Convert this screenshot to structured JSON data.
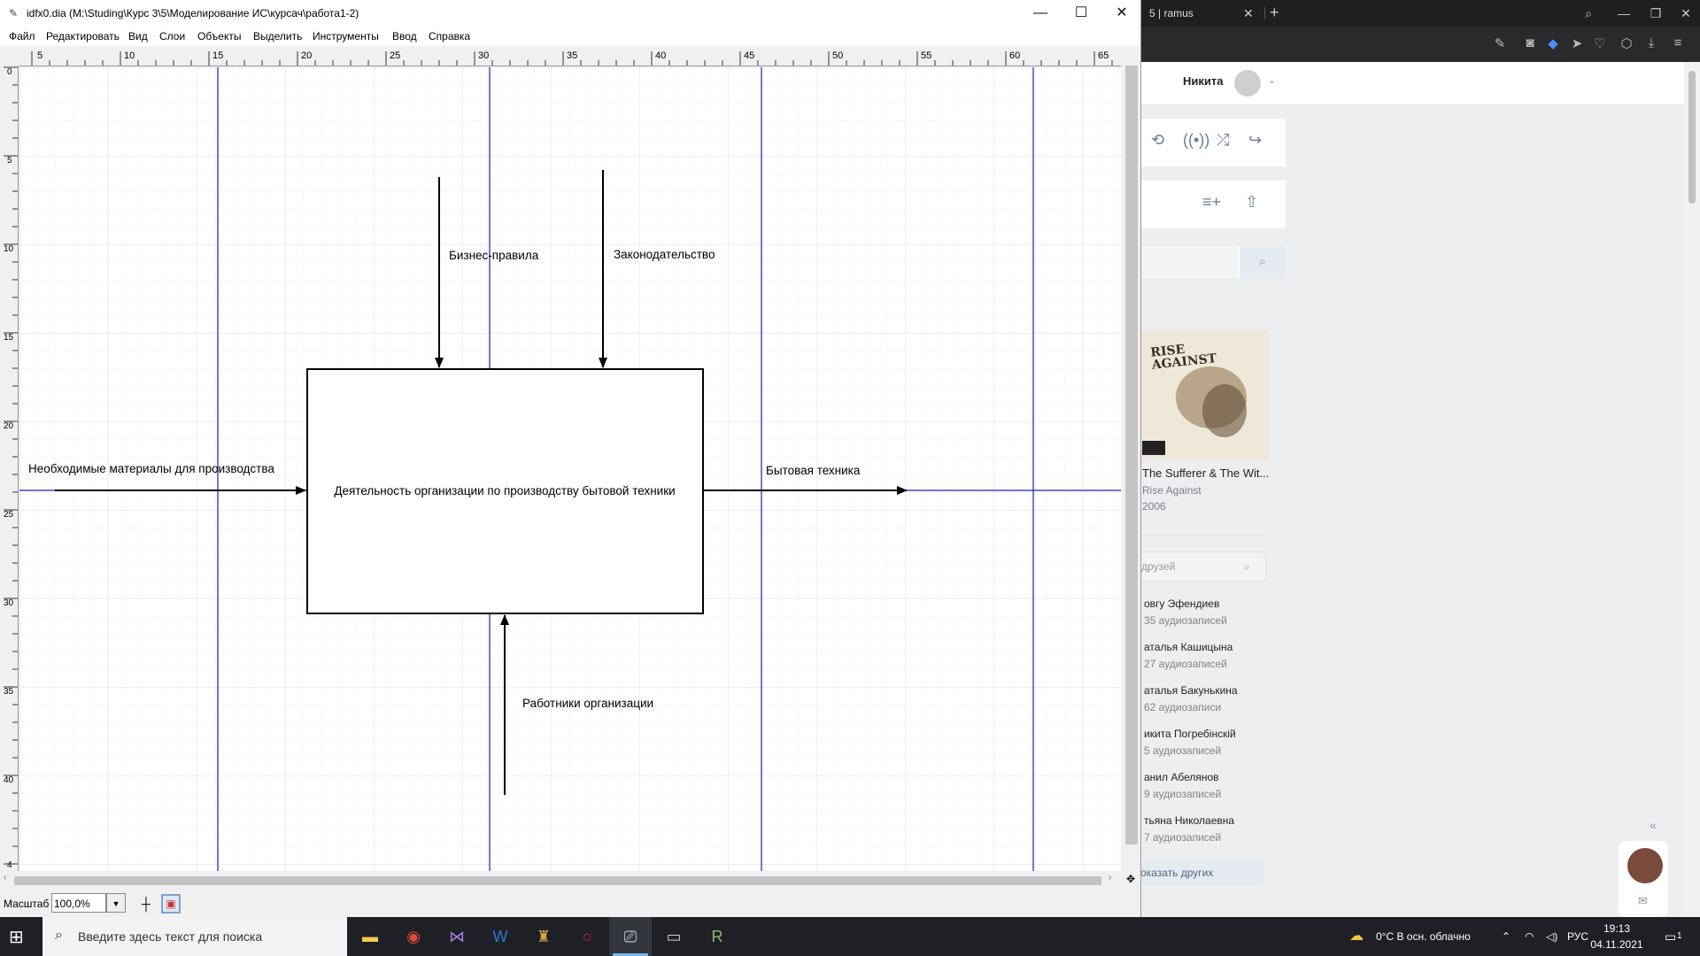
{
  "browser": {
    "tab_title": "5 | ramus",
    "tab_close": "✕",
    "new_tab": "+",
    "user_name": "Никита",
    "album": {
      "cover_logo": "RISE AGAINST",
      "title": "The Sufferer & The Wit...",
      "artist": "Rise Against",
      "year": "2006"
    },
    "friends_search_placeholder": "друзей",
    "friends": [
      {
        "name": "овгу Эфендиев",
        "count": "35 аудиозаписей"
      },
      {
        "name": "аталья Кашицына",
        "count": "27 аудиозаписей"
      },
      {
        "name": "аталья Бакунькина",
        "count": "62 аудиозаписи"
      },
      {
        "name": "икита Погребінскій",
        "count": "5 аудиозаписей"
      },
      {
        "name": "анил Абелянов",
        "count": "9 аудиозаписей"
      },
      {
        "name": "тьяна Николаевна",
        "count": "7 аудиозаписей"
      }
    ],
    "show_more": "оказать других",
    "collapse": "«"
  },
  "window": {
    "title": "idfx0.dia (M:\\Studing\\Курс 3\\5\\Моделирование ИС\\курсач\\работа1-2)",
    "minimize": "—",
    "maximize": "☐",
    "close": "✕"
  },
  "menu": [
    "Файл",
    "Редактировать",
    "Вид",
    "Слои",
    "Объекты",
    "Выделить",
    "Инструменты",
    "Ввод",
    "Справка"
  ],
  "ruler": {
    "h_labels": [
      "5",
      "10",
      "15",
      "20",
      "25",
      "30",
      "35",
      "40",
      "45",
      "50",
      "55",
      "60",
      "65"
    ],
    "v_labels": [
      "0",
      "5",
      "10",
      "15",
      "20",
      "25",
      "30",
      "35",
      "40",
      "4"
    ]
  },
  "diagram": {
    "box_label": "Деятельность организации по производству бытовой техники",
    "input_label": "Необходимые материалы для производства",
    "output_label": "Бытовая техника",
    "control1_label": "Бизнес-правила",
    "control2_label": "Законодательство",
    "mechanism_label": "Работники организации",
    "colors": {
      "guide": "#1e1eaa",
      "grid": "#dfe8ee",
      "line": "#000000"
    }
  },
  "statusbar": {
    "zoom_label": "Масштаб",
    "zoom_value": "100,0%"
  },
  "taskbar": {
    "search_placeholder": "Введите здесь текст для поиска",
    "weather": "0°C  В осн. облачно",
    "language": "РУС",
    "time": "19:13",
    "date": "04.11.2021",
    "notification_count": "1"
  }
}
